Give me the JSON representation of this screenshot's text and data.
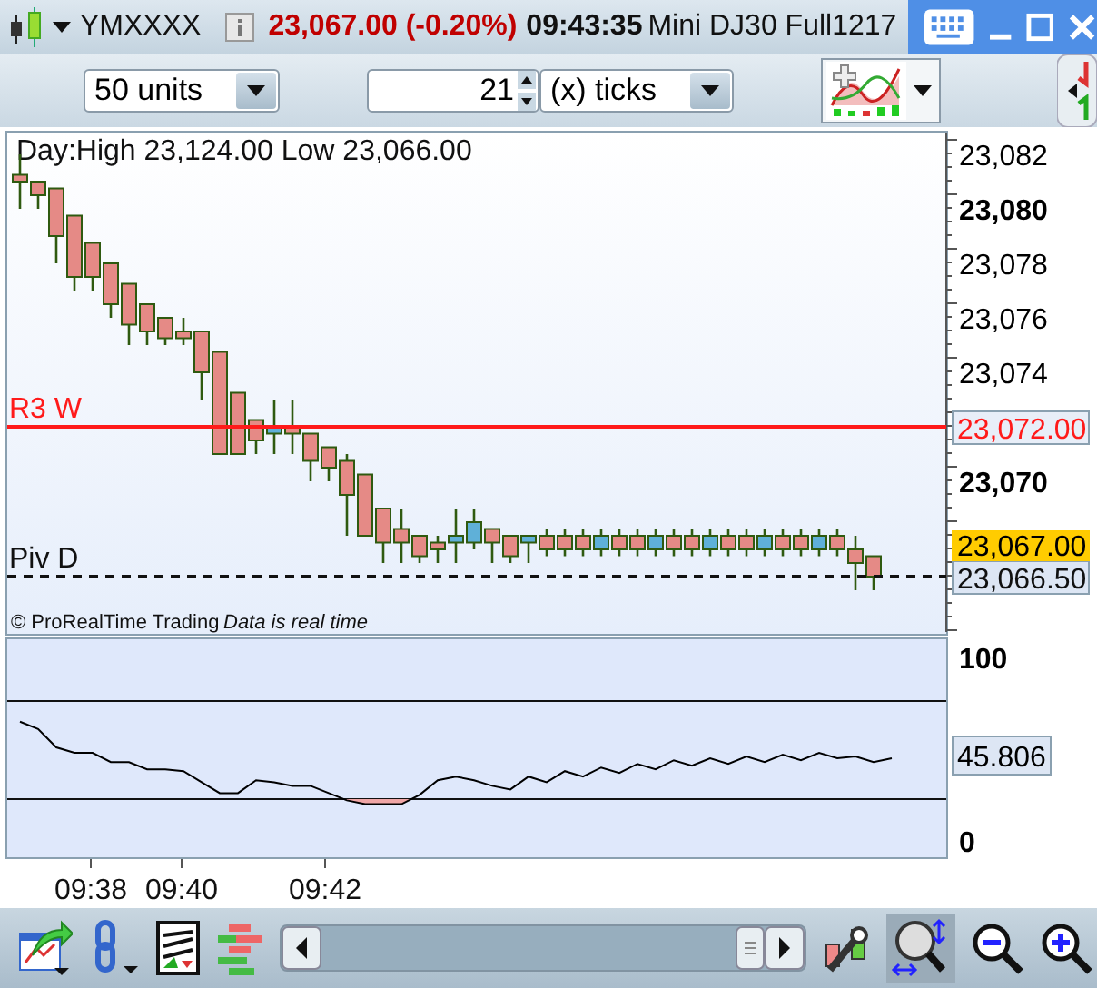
{
  "title_bar": {
    "symbol": "YMXXXX",
    "price_change": "23,067.00 (-0.20%)",
    "time": "09:43:35",
    "instrument": "Mini DJ30 Full1217"
  },
  "toolbar": {
    "period_select": {
      "value": "50 units"
    },
    "step_spinner": {
      "value": "21"
    },
    "unit_select": {
      "value": "(x) ticks"
    }
  },
  "price_panel": {
    "day_range": "Day:High 23,124.00 Low 23,066.00",
    "chart_data": {
      "type": "candlestick",
      "ylim": [
        23064.4,
        23082.8
      ],
      "yticks": [
        {
          "value": 23082,
          "label": "23,082"
        },
        {
          "value": 23080,
          "label": "23,080"
        },
        {
          "value": 23078,
          "label": "23,078"
        },
        {
          "value": 23076,
          "label": "23,076"
        },
        {
          "value": 23074,
          "label": "23,074"
        },
        {
          "value": 23070,
          "label": "23,070"
        }
      ],
      "ohlc": [
        [
          23081.25,
          23082,
          23080,
          23081
        ],
        [
          23081,
          23081,
          23080,
          23080.5
        ],
        [
          23080.75,
          23080.75,
          23078,
          23079
        ],
        [
          23079.75,
          23079.75,
          23077,
          23077.5
        ],
        [
          23078.75,
          23078.75,
          23077,
          23077.5
        ],
        [
          23078,
          23078,
          23076,
          23076.5
        ],
        [
          23077.25,
          23077.25,
          23075,
          23075.75
        ],
        [
          23076.5,
          23076.5,
          23075,
          23075.5
        ],
        [
          23076,
          23076,
          23075,
          23075.25
        ],
        [
          23075.5,
          23076,
          23075,
          23075.25
        ],
        [
          23075.5,
          23075.5,
          23073,
          23074
        ],
        [
          23074.75,
          23074.75,
          23071,
          23071
        ],
        [
          23073.25,
          23073.25,
          23071,
          23071
        ],
        [
          23072.25,
          23072.25,
          23071,
          23071.5
        ],
        [
          23071.75,
          23073,
          23071,
          23072
        ],
        [
          23072,
          23073,
          23071,
          23071.75
        ],
        [
          23071.75,
          23071.75,
          23070,
          23070.75
        ],
        [
          23071.25,
          23071.25,
          23070,
          23070.5
        ],
        [
          23070.75,
          23071,
          23068,
          23069.5
        ],
        [
          23070.25,
          23070.25,
          23068,
          23068
        ],
        [
          23069,
          23069,
          23067,
          23067.75
        ],
        [
          23068.25,
          23069,
          23067,
          23067.75
        ],
        [
          23068,
          23068,
          23067,
          23067.25
        ],
        [
          23067.75,
          23068,
          23067,
          23067.5
        ],
        [
          23067.75,
          23069,
          23067,
          23068
        ],
        [
          23067.75,
          23069,
          23067.5,
          23068.5
        ],
        [
          23068.25,
          23068.25,
          23067,
          23067.75
        ],
        [
          23068,
          23068,
          23067,
          23067.25
        ],
        [
          23067.75,
          23068,
          23067,
          23068
        ],
        [
          23068,
          23068.25,
          23067.25,
          23067.5
        ],
        [
          23068,
          23068.25,
          23067.25,
          23067.5
        ],
        [
          23068,
          23068.25,
          23067.25,
          23067.5
        ],
        [
          23067.5,
          23068.25,
          23067.25,
          23068
        ],
        [
          23068,
          23068.25,
          23067.25,
          23067.5
        ],
        [
          23068,
          23068.25,
          23067.25,
          23067.5
        ],
        [
          23067.5,
          23068.25,
          23067.25,
          23068
        ],
        [
          23068,
          23068.25,
          23067.25,
          23067.5
        ],
        [
          23068,
          23068.25,
          23067.25,
          23067.5
        ],
        [
          23067.5,
          23068.25,
          23067.25,
          23068
        ],
        [
          23068,
          23068.25,
          23067.25,
          23067.5
        ],
        [
          23068,
          23068.25,
          23067.25,
          23067.5
        ],
        [
          23067.5,
          23068.25,
          23067.25,
          23068
        ],
        [
          23068,
          23068.25,
          23067.25,
          23067.5
        ],
        [
          23068,
          23068.25,
          23067.25,
          23067.5
        ],
        [
          23067.5,
          23068.25,
          23067.25,
          23068
        ],
        [
          23068,
          23068.25,
          23067.25,
          23067.5
        ],
        [
          23067.5,
          23068,
          23066,
          23067
        ],
        [
          23067.25,
          23067.25,
          23066,
          23066.5
        ]
      ]
    },
    "axis_label_bold": [
      false,
      true,
      false,
      false,
      false,
      true
    ],
    "levels": [
      {
        "label": "R3 W",
        "price_tag": "23,072.00",
        "kind": "solid"
      },
      {
        "label": "Piv D",
        "price_tag": "23,066.50",
        "kind": "dashed"
      }
    ],
    "last_price_tag": "23,067.00",
    "copyright": "© ProRealTime Trading",
    "data_note": "Data is real time"
  },
  "oscillator_panel": {
    "value_tag": "45.806",
    "chart_data": {
      "type": "line",
      "ylim": [
        -9,
        110
      ],
      "yticks": [
        0,
        100
      ],
      "series": [
        {
          "color": "#000000",
          "values": [
            65,
            61,
            51,
            48,
            48,
            43,
            43,
            39,
            39,
            38,
            32,
            26,
            26,
            33,
            32,
            30,
            30,
            26,
            22,
            20,
            20,
            20,
            25,
            33,
            35,
            33,
            30,
            28,
            35,
            32,
            38,
            35,
            40,
            37,
            42,
            39,
            44,
            41,
            45,
            42,
            46,
            43,
            47,
            44,
            48,
            45,
            46,
            43,
            45
          ]
        }
      ]
    }
  },
  "time_axis": [
    "09:38",
    "09:40",
    "09:42"
  ],
  "bottom_toolbar": {
    "zoom_area": {
      "selected": true
    }
  }
}
